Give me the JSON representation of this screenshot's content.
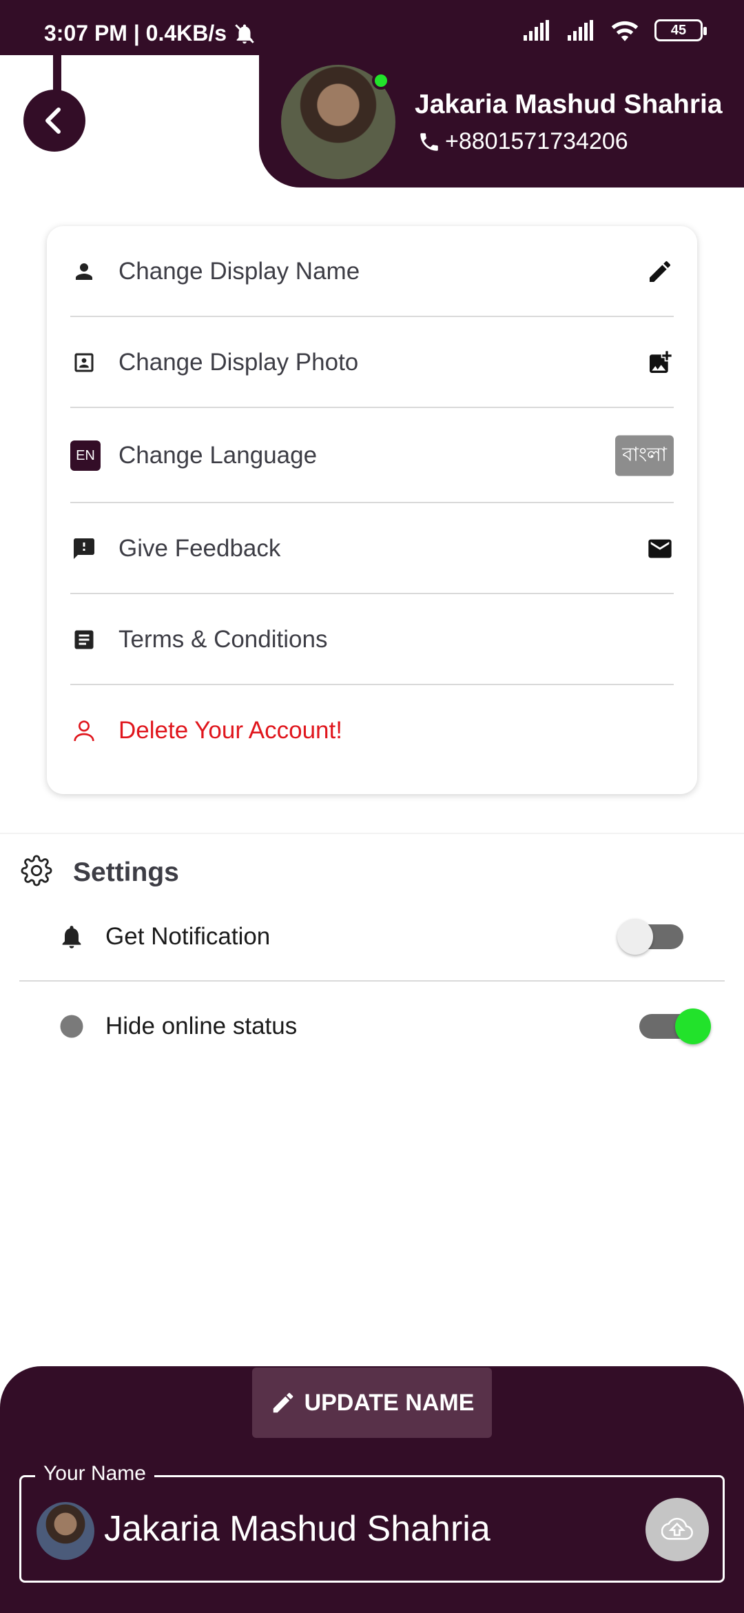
{
  "status_bar": {
    "time_speed": "3:07 PM | 0.4KB/s",
    "battery": "45",
    "icons": [
      "mute-icon",
      "signal-icon",
      "signal-icon",
      "wifi-icon",
      "battery-icon"
    ]
  },
  "header": {
    "user_name": "Jakaria Mashud Shahria",
    "phone": "+8801571734206",
    "online": true
  },
  "menu": {
    "items": [
      {
        "label": "Change Display Name",
        "icon": "person-icon",
        "right_icon": "pencil-icon"
      },
      {
        "label": "Change Display Photo",
        "icon": "portrait-icon",
        "right_icon": "add-photo-icon"
      },
      {
        "label": "Change Language",
        "icon": "EN",
        "right_label": "বাংলা"
      },
      {
        "label": "Give Feedback",
        "icon": "feedback-icon",
        "right_icon": "mail-icon"
      },
      {
        "label": "Terms & Conditions",
        "icon": "document-icon"
      },
      {
        "label": "Delete Your Account!",
        "icon": "person-outline-icon",
        "color": "#e0161d"
      }
    ]
  },
  "settings": {
    "title": "Settings",
    "items": [
      {
        "label": "Get Notification",
        "icon": "bell-icon",
        "enabled": false
      },
      {
        "label": "Hide online status",
        "icon": "dot-icon",
        "enabled": true
      }
    ]
  },
  "bottom": {
    "update_button": "UPDATE NAME",
    "field_label": "Your Name",
    "field_value": "Jakaria Mashud Shahria"
  },
  "colors": {
    "brand": "#330d27",
    "online": "#22e22b",
    "danger": "#e0161d"
  }
}
